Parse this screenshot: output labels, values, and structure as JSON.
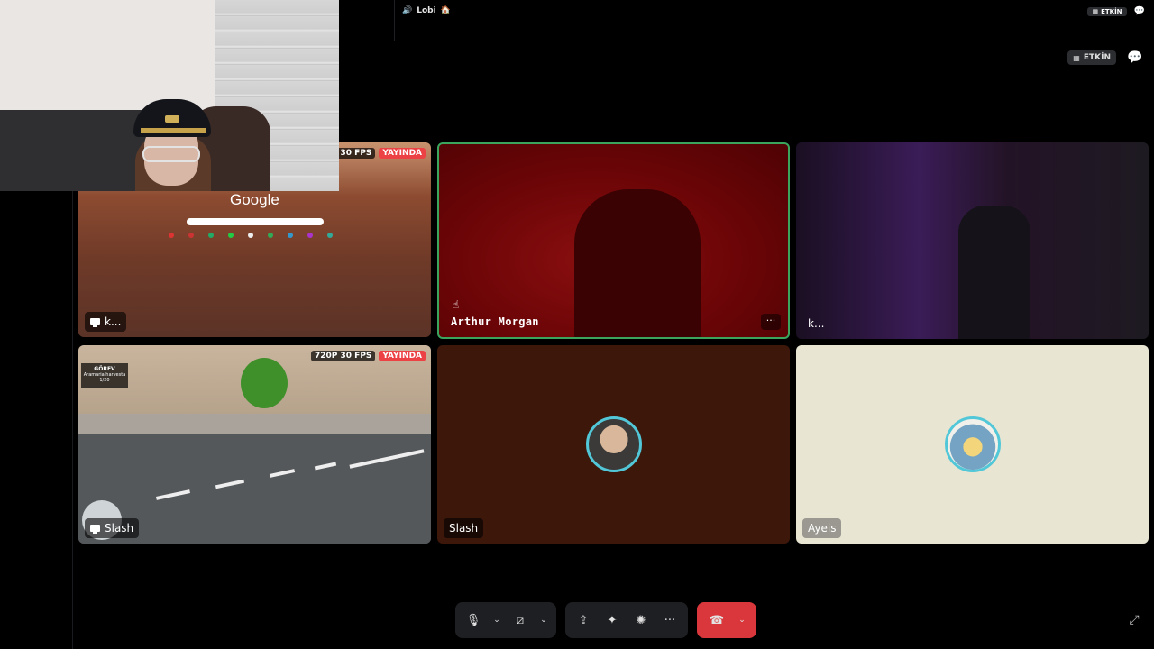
{
  "channel": {
    "name": "Lobi",
    "emoji": "🏠"
  },
  "header": {
    "activity_label": "ETKİN",
    "activity_label_mini": "ETKİN"
  },
  "tiles": [
    {
      "name": "k...",
      "resolution": "720P 30 FPS",
      "live": "YAYINDA",
      "content_title": "Google"
    },
    {
      "name": "Arthur Morgan",
      "more": "···"
    },
    {
      "name": "k..."
    },
    {
      "name": "Slash",
      "resolution": "720P 30 FPS",
      "live": "YAYINDA",
      "hud_title": "GÖREV",
      "hud_sub1": "Aramaria harvesta",
      "hud_sub2": "1/20"
    },
    {
      "name": "Slash"
    },
    {
      "name": "Ayeis"
    }
  ],
  "controls": {
    "mic": "🎙",
    "camera": "⧄",
    "screenshare": "⇪",
    "activities": "✦",
    "soundboard": "✺",
    "more": "···",
    "leave": "☎",
    "chevron": "⌄",
    "fullscreen": "⤢"
  },
  "icons": [
    "speaker-icon",
    "calendar-icon",
    "chat-icon",
    "microphone-icon",
    "camera-off-icon",
    "screen-share-icon",
    "activities-icon",
    "soundboard-icon",
    "more-icon",
    "hang-up-icon",
    "chevron-down-icon",
    "fullscreen-exit-icon"
  ],
  "colors": {
    "speaking_border": "#3ba55d",
    "live_badge": "#ed4245",
    "hangup": "#da373c",
    "avatar_ring": "#52c7d8"
  }
}
